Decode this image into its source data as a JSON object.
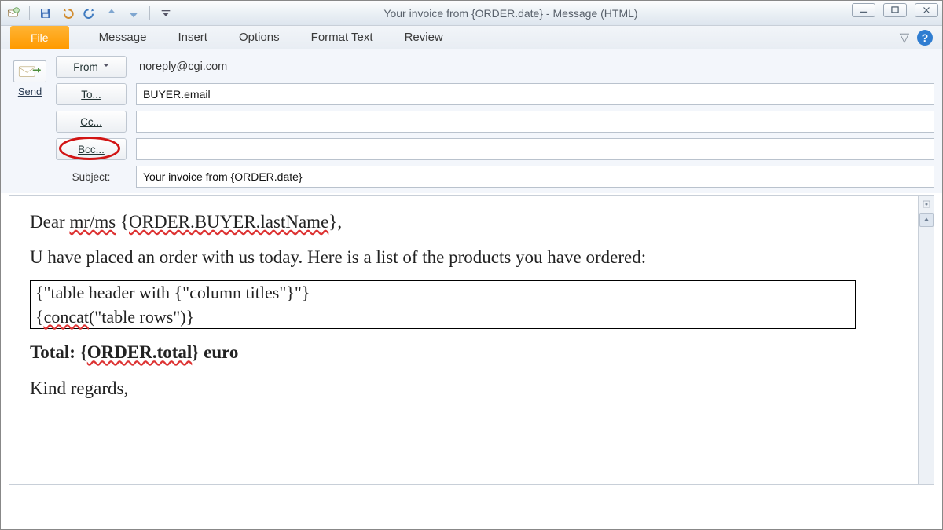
{
  "window": {
    "title": "Your invoice from {ORDER.date}  -  Message (HTML)"
  },
  "ribbon": {
    "file": "File",
    "tabs": [
      "Message",
      "Insert",
      "Options",
      "Format Text",
      "Review"
    ]
  },
  "compose": {
    "send_label": "Send",
    "from_btn": "From",
    "from_value": "noreply@cgi.com",
    "to_btn": "To...",
    "to_value": "BUYER.email",
    "cc_btn": "Cc...",
    "cc_value": "",
    "bcc_btn": "Bcc...",
    "bcc_value": "",
    "subject_label": "Subject:",
    "subject_value": "Your invoice from {ORDER.date}"
  },
  "body": {
    "line1_a": "Dear ",
    "line1_b": "mr/ms",
    "line1_c": " {",
    "line1_d": "ORDER.BUYER.lastName",
    "line1_e": "},",
    "para2": "U have placed an order with us today. Here is a list of the products you have ordered:",
    "tcell1": "{\"table header with {\"column titles\"}\"}",
    "tcell2_a": "{",
    "tcell2_b": "concat",
    "tcell2_c": "(\"table rows\")}",
    "total_a": "Total: {",
    "total_b": "ORDER.total",
    "total_c": "} euro",
    "signoff": "Kind regards,"
  }
}
